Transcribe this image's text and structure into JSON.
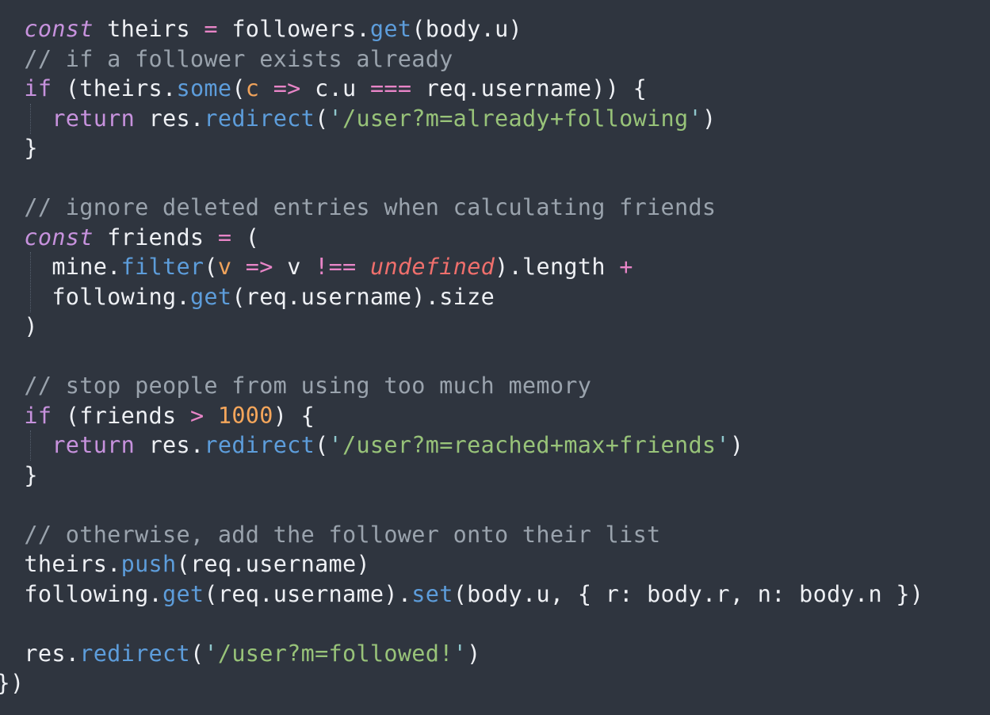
{
  "editor": {
    "theme": {
      "background": "#2f353f",
      "text": "#eef0f4",
      "keyword": "#c792dd",
      "comment": "#9aa3ad",
      "method": "#5d9ddb",
      "string": "#98c379",
      "number": "#f5a65b",
      "undefined": "#ef6f6c"
    },
    "lines": [
      {
        "indent": "  ",
        "tokens": [
          {
            "t": "keyword-italic",
            "v": "const"
          },
          {
            "t": "ident",
            "v": " theirs "
          },
          {
            "t": "operator",
            "v": "="
          },
          {
            "t": "ident",
            "v": " followers"
          },
          {
            "t": "punct",
            "v": "."
          },
          {
            "t": "method",
            "v": "get"
          },
          {
            "t": "punct",
            "v": "(body.u)"
          }
        ]
      },
      {
        "indent": "  ",
        "tokens": [
          {
            "t": "comment",
            "v": "// if a follower exists already"
          }
        ]
      },
      {
        "indent": "  ",
        "tokens": [
          {
            "t": "keyword",
            "v": "if"
          },
          {
            "t": "punct",
            "v": " (theirs."
          },
          {
            "t": "method",
            "v": "some"
          },
          {
            "t": "punct",
            "v": "("
          },
          {
            "t": "param",
            "v": "c"
          },
          {
            "t": "operator",
            "v": " =>"
          },
          {
            "t": "ident",
            "v": " c.u "
          },
          {
            "t": "operator",
            "v": "==="
          },
          {
            "t": "ident",
            "v": " req.username)) {"
          }
        ]
      },
      {
        "indent": "    ",
        "tokens": [
          {
            "t": "keyword",
            "v": "return"
          },
          {
            "t": "ident",
            "v": " res."
          },
          {
            "t": "method",
            "v": "redirect"
          },
          {
            "t": "punct",
            "v": "("
          },
          {
            "t": "quote",
            "v": "'"
          },
          {
            "t": "string",
            "v": "/user?m=already+following"
          },
          {
            "t": "quote",
            "v": "'"
          },
          {
            "t": "punct",
            "v": ")"
          }
        ]
      },
      {
        "indent": "  ",
        "tokens": [
          {
            "t": "punct",
            "v": "}"
          }
        ]
      },
      {
        "indent": "",
        "tokens": []
      },
      {
        "indent": "  ",
        "tokens": [
          {
            "t": "comment",
            "v": "// ignore deleted entries when calculating friends"
          }
        ]
      },
      {
        "indent": "  ",
        "tokens": [
          {
            "t": "keyword-italic",
            "v": "const"
          },
          {
            "t": "ident",
            "v": " friends "
          },
          {
            "t": "operator",
            "v": "="
          },
          {
            "t": "punct",
            "v": " ("
          }
        ]
      },
      {
        "indent": "    ",
        "tokens": [
          {
            "t": "ident",
            "v": "mine."
          },
          {
            "t": "method",
            "v": "filter"
          },
          {
            "t": "punct",
            "v": "("
          },
          {
            "t": "param",
            "v": "v"
          },
          {
            "t": "operator",
            "v": " =>"
          },
          {
            "t": "ident",
            "v": " v "
          },
          {
            "t": "operator",
            "v": "!=="
          },
          {
            "t": "ident",
            "v": " "
          },
          {
            "t": "undef",
            "v": "undefined"
          },
          {
            "t": "punct",
            "v": ").length "
          },
          {
            "t": "operator",
            "v": "+"
          }
        ]
      },
      {
        "indent": "    ",
        "tokens": [
          {
            "t": "ident",
            "v": "following."
          },
          {
            "t": "method",
            "v": "get"
          },
          {
            "t": "punct",
            "v": "(req.username).size"
          }
        ]
      },
      {
        "indent": "  ",
        "tokens": [
          {
            "t": "punct",
            "v": ")"
          }
        ]
      },
      {
        "indent": "",
        "tokens": []
      },
      {
        "indent": "  ",
        "tokens": [
          {
            "t": "comment",
            "v": "// stop people from using too much memory"
          }
        ]
      },
      {
        "indent": "  ",
        "tokens": [
          {
            "t": "keyword",
            "v": "if"
          },
          {
            "t": "punct",
            "v": " (friends "
          },
          {
            "t": "operator",
            "v": ">"
          },
          {
            "t": "ident",
            "v": " "
          },
          {
            "t": "number",
            "v": "1000"
          },
          {
            "t": "punct",
            "v": ") {"
          }
        ]
      },
      {
        "indent": "    ",
        "tokens": [
          {
            "t": "keyword",
            "v": "return"
          },
          {
            "t": "ident",
            "v": " res."
          },
          {
            "t": "method",
            "v": "redirect"
          },
          {
            "t": "punct",
            "v": "("
          },
          {
            "t": "quote",
            "v": "'"
          },
          {
            "t": "string",
            "v": "/user?m=reached+max+friends"
          },
          {
            "t": "quote",
            "v": "'"
          },
          {
            "t": "punct",
            "v": ")"
          }
        ]
      },
      {
        "indent": "  ",
        "tokens": [
          {
            "t": "punct",
            "v": "}"
          }
        ]
      },
      {
        "indent": "",
        "tokens": []
      },
      {
        "indent": "  ",
        "tokens": [
          {
            "t": "comment",
            "v": "// otherwise, add the follower onto their list"
          }
        ]
      },
      {
        "indent": "  ",
        "tokens": [
          {
            "t": "ident",
            "v": "theirs."
          },
          {
            "t": "method",
            "v": "push"
          },
          {
            "t": "punct",
            "v": "(req.username)"
          }
        ]
      },
      {
        "indent": "  ",
        "tokens": [
          {
            "t": "ident",
            "v": "following."
          },
          {
            "t": "method",
            "v": "get"
          },
          {
            "t": "punct",
            "v": "(req.username)."
          },
          {
            "t": "method",
            "v": "set"
          },
          {
            "t": "punct",
            "v": "(body.u, { r: body.r, n: body.n })"
          }
        ]
      },
      {
        "indent": "",
        "tokens": []
      },
      {
        "indent": "  ",
        "tokens": [
          {
            "t": "ident",
            "v": "res."
          },
          {
            "t": "method",
            "v": "redirect"
          },
          {
            "t": "punct",
            "v": "("
          },
          {
            "t": "quote",
            "v": "'"
          },
          {
            "t": "string",
            "v": "/user?m=followed!"
          },
          {
            "t": "quote",
            "v": "'"
          },
          {
            "t": "punct",
            "v": ")"
          }
        ]
      },
      {
        "indent": "",
        "tokens": [
          {
            "t": "punct",
            "v": "})"
          }
        ]
      }
    ]
  }
}
